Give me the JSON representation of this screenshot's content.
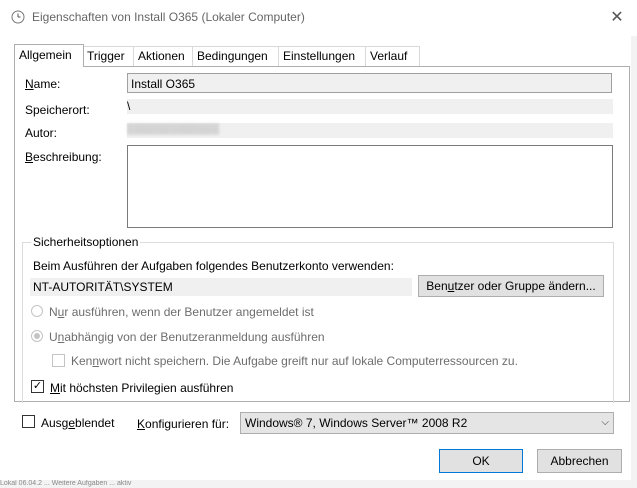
{
  "window": {
    "title": "Eigenschaften von Install O365 (Lokaler Computer)",
    "close_glyph": "✕"
  },
  "tabs": [
    {
      "label": "Allgemein",
      "active": true
    },
    {
      "label": "Trigger"
    },
    {
      "label": "Aktionen"
    },
    {
      "label": "Bedingungen"
    },
    {
      "label": "Einstellungen"
    },
    {
      "label": "Verlauf"
    }
  ],
  "general": {
    "name_label_u": "N",
    "name_label_rest": "ame:",
    "name_value": "Install O365",
    "location_label": "Speicherort:",
    "location_value": "\\",
    "author_label": "Autor:",
    "author_value": "▒▒▒▒▒▒▒▒▒▒▒▒▒",
    "description_label_u": "B",
    "description_label_rest": "eschreibung:",
    "description_value": ""
  },
  "security": {
    "legend": "Sicherheitsoptionen",
    "account_prompt": "Beim Ausführen der Aufgaben folgendes Benutzerkonto verwenden:",
    "account_value": "NT-AUTORITÄT\\SYSTEM",
    "change_button_pre": "Ben",
    "change_button_u": "u",
    "change_button_post": "tzer oder Gruppe ändern...",
    "option_logged_on_pre": "N",
    "option_logged_on_u": "u",
    "option_logged_on_post": "r ausführen, wenn der Benutzer angemeldet ist",
    "option_independent_pre": "U",
    "option_independent_u": "n",
    "option_independent_post": "abhängig von der Benutzeranmeldung ausführen",
    "no_password_pre": "Ken",
    "no_password_u": "n",
    "no_password_post": "wort nicht speichern. Die Aufgabe greift nur auf lokale Computerressourcen zu.",
    "highest_privileges_u": "M",
    "highest_privileges_rest": "it höchsten Privilegien ausführen",
    "highest_privileges_checked": "✓"
  },
  "footer": {
    "hidden_label_pre": "Ausg",
    "hidden_label_u": "e",
    "hidden_label_post": "blendet",
    "configure_label_u": "K",
    "configure_label_rest": "onfigurieren für:",
    "configure_value": "Windows® 7, Windows Server™ 2008 R2",
    "ok_label": "OK",
    "cancel_label": "Abbrechen"
  },
  "background": {
    "bottom_text": "Lokal  06.04.2  ...  Weitere Aufgaben  ...  aktiv"
  }
}
